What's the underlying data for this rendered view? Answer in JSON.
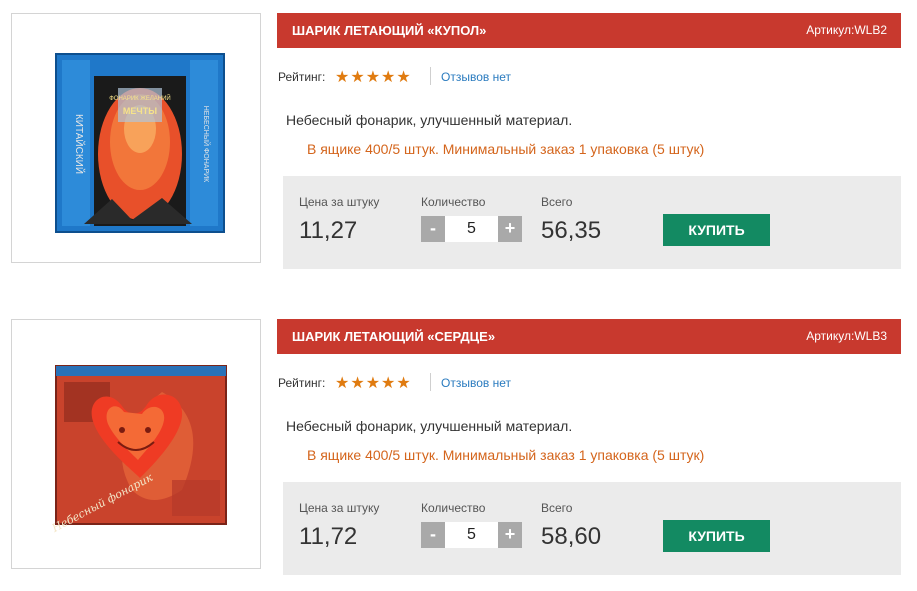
{
  "products": [
    {
      "name": "ШАРИК ЛЕТАЮЩИЙ «КУПОЛ»",
      "sku": "Артикул:WLB2",
      "rating_label": "Рейтинг:",
      "rating": 5,
      "reviews_link": "Отзывов нет",
      "description": "Небесный фонарик, улучшенный материал.",
      "packing": "В ящике 400/5 штук. Минимальный заказ 1 упаковка (5 штук)",
      "unit_price_label": "Цена за штуку",
      "unit_price": "11,27",
      "quantity_label": "Количество",
      "quantity": "5",
      "minus_label": "-",
      "plus_label": "+",
      "total_label": "Всего",
      "total": "56,35",
      "buy_label": "КУПИТЬ",
      "image_text": [
        "КИТАЙСКИЙ",
        "НЕБЕСНЫЙ ФОНАРИК",
        "ФОНАРИК ЖЕЛАНИЙ",
        "МЕЧТЫ"
      ]
    },
    {
      "name": "ШАРИК ЛЕТАЮЩИЙ «СЕРДЦЕ»",
      "sku": "Артикул:WLB3",
      "rating_label": "Рейтинг:",
      "rating": 5,
      "reviews_link": "Отзывов нет",
      "description": "Небесный фонарик, улучшенный материал.",
      "packing": "В ящике 400/5 штук. Минимальный заказ 1 упаковка (5 штук)",
      "unit_price_label": "Цена за штуку",
      "unit_price": "11,72",
      "quantity_label": "Количество",
      "quantity": "5",
      "minus_label": "-",
      "plus_label": "+",
      "total_label": "Всего",
      "total": "58,60",
      "buy_label": "КУПИТЬ",
      "image_text": [
        "Небесный фонарик"
      ]
    }
  ],
  "colors": {
    "title_bar": "#c8392e",
    "star": "#e07b10",
    "link": "#2a7bbf",
    "packing_text": "#d4651c",
    "buy_button": "#138a62",
    "price_box": "#ebebeb"
  }
}
